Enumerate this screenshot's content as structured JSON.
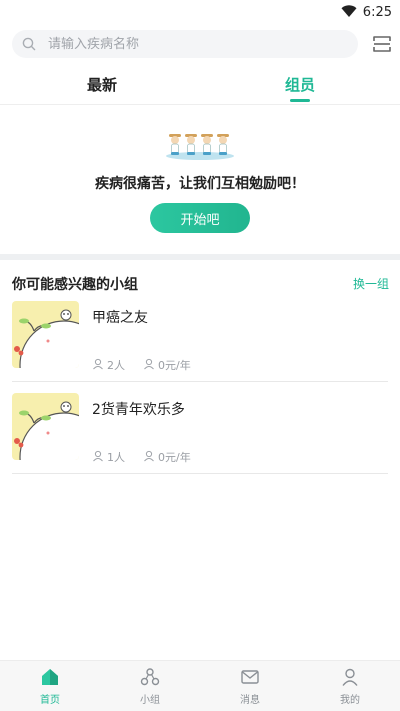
{
  "status": {
    "time": "6:25"
  },
  "search": {
    "placeholder": "请输入疾病名称"
  },
  "tabs": [
    {
      "label": "最新",
      "active": false
    },
    {
      "label": "组员",
      "active": true
    }
  ],
  "hero": {
    "message": "疾病很痛苦，让我们互相勉励吧！",
    "button_label": "开始吧"
  },
  "section": {
    "title": "你可能感兴趣的小组",
    "action_label": "换一组"
  },
  "groups": [
    {
      "name": "甲癌之友",
      "members": "2人",
      "fee": "0元/年"
    },
    {
      "name": "2货青年欢乐多",
      "members": "1人",
      "fee": "0元/年"
    }
  ],
  "bottom_nav": [
    {
      "label": "首页",
      "icon": "home-icon",
      "active": true
    },
    {
      "label": "小组",
      "icon": "group-icon",
      "active": false
    },
    {
      "label": "消息",
      "icon": "message-icon",
      "active": false
    },
    {
      "label": "我的",
      "icon": "profile-icon",
      "active": false
    }
  ],
  "colors": {
    "accent": "#1fb895",
    "thumb_bg": "#f7efae"
  }
}
